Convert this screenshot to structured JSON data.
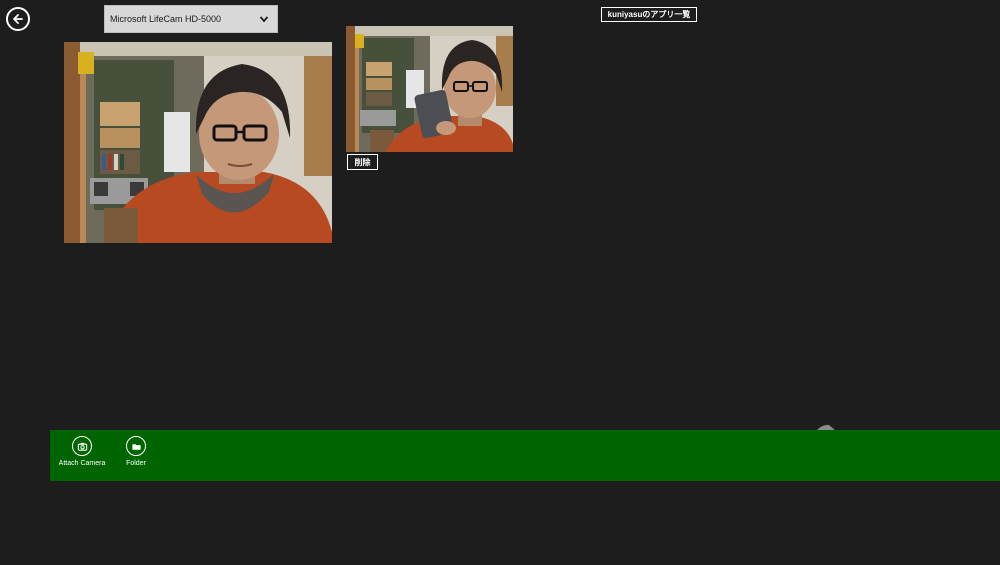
{
  "navigation": {
    "back_icon": "back-arrow-icon"
  },
  "device_select": {
    "value": "Microsoft LifeCam HD-5000",
    "chevron_icon": "chevron-down-icon"
  },
  "header": {
    "app_list_button": "kuniyasuのアプリ一覧"
  },
  "photos": {
    "large_alt": "camera-photo-large",
    "small_alt": "camera-photo-small",
    "delete_label": "削除"
  },
  "app_bar": {
    "color": "#006400",
    "commands": [
      {
        "label": "Attach Camera",
        "icon": "camera-icon"
      },
      {
        "label": "Folder",
        "icon": "folder-icon"
      }
    ]
  },
  "colors": {
    "background": "#1d1d1d",
    "app_bar": "#006400",
    "dropdown": "#d8d8d8"
  }
}
